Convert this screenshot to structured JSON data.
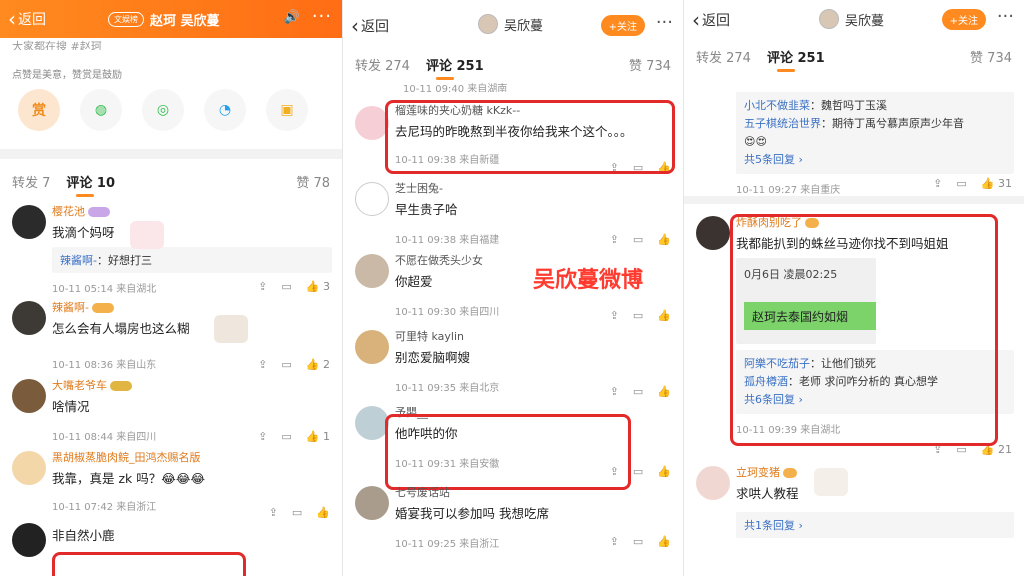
{
  "p1": {
    "back": "返回",
    "tag": "文娱榜",
    "title": "赵珂 吴欣蔓",
    "top_text": "大家都在搜 #赵珂",
    "reward_note": "点赞是美意，赞赏是鼓励",
    "reward_label": "赏",
    "tabs": {
      "repost": "转发 7",
      "comments": "评论 10",
      "likes": "赞 78"
    },
    "comments": [
      {
        "name": "樱花池",
        "text": "我滴个妈呀",
        "reply_name": "辣酱啊-",
        "reply_text": "：好想打三",
        "meta": "10-11 05:14  来自湖北",
        "like": "3"
      },
      {
        "name": "辣酱啊-",
        "text": "怎么会有人塌房也这么糊",
        "meta": "10-11 08:36  来自山东",
        "like": "2"
      },
      {
        "name": "大嘴老爷车",
        "text": "啥情况",
        "meta": "10-11 08:44  来自四川",
        "like": "1"
      },
      {
        "name": "黑胡椒蒸脆肉鲩_田鸿杰赐名版",
        "text": "我靠，真是 zk 吗？😂😂😂",
        "meta": "10-11 07:42  来自浙江",
        "like": ""
      },
      {
        "name": "",
        "text": "非自然小鹿",
        "meta": "",
        "like": ""
      }
    ]
  },
  "p2": {
    "back": "返回",
    "title": "吴欣蔓",
    "follow": "+关注",
    "tabs": {
      "repost": "转发 274",
      "comments": "评论 251",
      "likes": "赞 734"
    },
    "top_meta": "10-11 09:40  来自湖南",
    "watermark": "吴欣蔓微博",
    "comments": [
      {
        "name": "榴莲味的夹心奶糖 kKzk--",
        "text": "去尼玛的昨晚熬到半夜你给我来个这个。。。",
        "meta": "10-11 09:38  来自新疆"
      },
      {
        "name": "芝士困兔-",
        "text": "早生贵子哈",
        "meta": "10-11 09:38  来自福建"
      },
      {
        "name": "不愿在做秃头少女",
        "text": "你超爱",
        "meta": "10-11 09:30  来自四川"
      },
      {
        "name": "可里特 kaylin",
        "text": "别恋爱脑啊嫂",
        "meta": "10-11 09:35  来自北京"
      },
      {
        "name": "予嬰__",
        "text": "他咋哄的你",
        "meta": "10-11 09:31  来自安徽"
      },
      {
        "name": "七号废话站",
        "text": "婚宴我可以参加吗 我想吃席",
        "meta": "10-11 09:25  来自浙江"
      }
    ]
  },
  "p3": {
    "back": "返回",
    "title": "吴欣蔓",
    "follow": "+关注",
    "tabs": {
      "repost": "转发 274",
      "comments": "评论 251",
      "likes": "赞 734"
    },
    "top_reply": {
      "r1_name": "小北不做韭菜",
      "r1_text": "：魏哲吗丁玉溪",
      "r2_name": "五子棋统治世界",
      "r2_text": "：期待丁禹兮慕声原声少年音",
      "more": "共5条回复 ›",
      "meta": "10-11 09:27  来自重庆",
      "like": "31"
    },
    "c1": {
      "name": "炸酥肉别吃了",
      "text": "我都能扒到的蛛丝马迹你找不到吗姐姐",
      "img_time": "0月6日 凌晨02:25",
      "img_green": "赵珂去泰国约如烟",
      "r1_name": "阿樂不吃茄子",
      "r1_text": "：让他们锁死",
      "r2_name": "孤舟樽酒",
      "r2_text": "：老师 求问咋分析的 真心想学",
      "more": "共6条回复 ›",
      "meta": "10-11 09:39  来自湖北",
      "like": "21"
    },
    "c2": {
      "name": "立珂变猪",
      "text": "求哄人教程",
      "more": "共1条回复 ›"
    }
  }
}
